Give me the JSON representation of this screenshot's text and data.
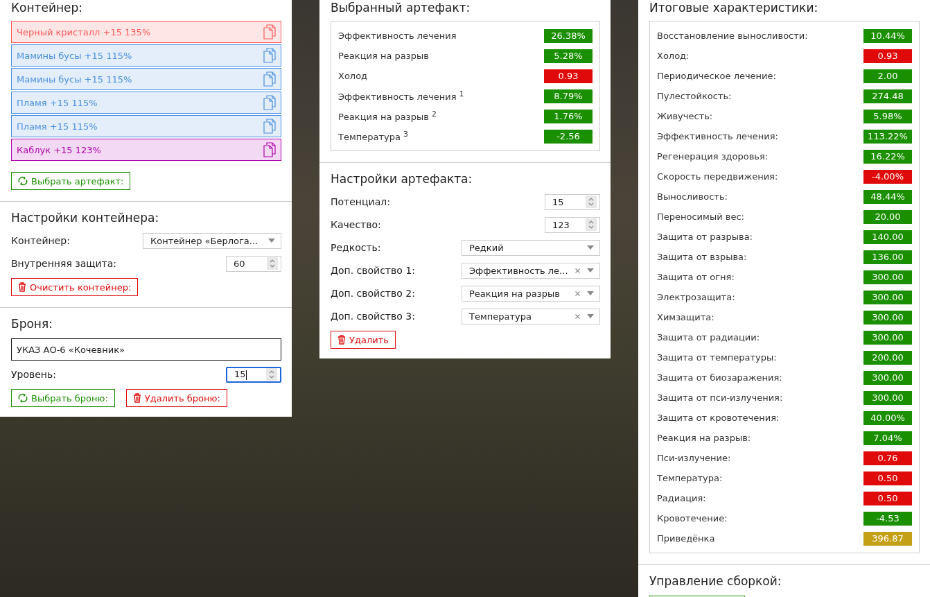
{
  "container": {
    "title": "Контейнер:",
    "artifacts": [
      {
        "label": "Черный кристалл +15 135%",
        "color": "#ff5a5a"
      },
      {
        "label": "Мамины бусы +15 115%",
        "color": "#4a90e2"
      },
      {
        "label": "Мамины бусы +15 115%",
        "color": "#4a90e2"
      },
      {
        "label": "Пламя +15 115%",
        "color": "#4a90e2"
      },
      {
        "label": "Пламя +15 115%",
        "color": "#4a90e2"
      },
      {
        "label": "Каблук +15 123%",
        "color": "#b000b0"
      }
    ],
    "pick_button": "Выбрать артефакт:"
  },
  "container_settings": {
    "title": "Настройки контейнера:",
    "fields": [
      {
        "kind": "select",
        "label": "Контейнер:",
        "value": "Контейнер «Берлога..."
      },
      {
        "kind": "number",
        "label": "Внутренняя защита:",
        "value": "60",
        "focused": false
      }
    ],
    "clear_button": "Очистить контейнер:"
  },
  "armor": {
    "title": "Броня:",
    "name": "УКАЗ АО-6 «Кочевник»",
    "fields": [
      {
        "kind": "number",
        "label": "Уровень:",
        "value": "15",
        "focused": true
      }
    ],
    "pick_button": "Выбрать броню:",
    "delete_button": "Удалить броню:"
  },
  "selected_artifact": {
    "title": "Выбранный артефакт:",
    "stats": [
      {
        "label": "Эффективность лечения",
        "value": "26.38%",
        "color": "#1a9000"
      },
      {
        "label": "Реакция на разрыв",
        "value": "5.28%",
        "color": "#1a9000"
      },
      {
        "label": "Холод",
        "value": "0.93",
        "color": "#e00a0a"
      },
      {
        "label": "Эффективность лечения $^{1}$",
        "value": "8.79%",
        "color": "#1a9000"
      },
      {
        "label": "Реакция на разрыв $^{2}$",
        "value": "1.76%",
        "color": "#1a9000"
      },
      {
        "label": "Температура $^{3}$",
        "value": "-2.56",
        "color": "#1a9000"
      }
    ]
  },
  "artifact_settings": {
    "title": "Настройки артефакта:",
    "fields": [
      {
        "kind": "number",
        "label": "Потенциал:",
        "value": "15",
        "focused": false
      },
      {
        "kind": "number",
        "label": "Качество:",
        "value": "123",
        "focused": false
      },
      {
        "kind": "select",
        "label": "Редкость:",
        "value": "Редкий"
      },
      {
        "kind": "select",
        "label": "Доп. свойство 1:",
        "value": "Эффективность ле...",
        "clearable": true
      },
      {
        "kind": "select",
        "label": "Доп. свойство 2:",
        "value": "Реакция на разрыв",
        "clearable": true
      },
      {
        "kind": "select",
        "label": "Доп. свойство 3:",
        "value": "Температура",
        "clearable": true
      }
    ],
    "delete_button": "Удалить"
  },
  "totals": {
    "title": "Итоговые характеристики:",
    "stats": [
      {
        "label": "Восстановление выносливости:",
        "value": "10.44%",
        "color": "#1a9000"
      },
      {
        "label": "Холод:",
        "value": "0.93",
        "color": "#e00a0a"
      },
      {
        "label": "Периодическое лечение:",
        "value": "2.00",
        "color": "#1a9000"
      },
      {
        "label": "Пулестойкость:",
        "value": "274.48",
        "color": "#1a9000"
      },
      {
        "label": "Живучесть:",
        "value": "5.98%",
        "color": "#1a9000"
      },
      {
        "label": "Эффективность лечения:",
        "value": "113.22%",
        "color": "#1a9000"
      },
      {
        "label": "Регенерация здоровья:",
        "value": "16.22%",
        "color": "#1a9000"
      },
      {
        "label": "Скорость передвижения:",
        "value": "-4.00%",
        "color": "#e00a0a"
      },
      {
        "label": "Выносливость:",
        "value": "48.44%",
        "color": "#1a9000"
      },
      {
        "label": "Переносимый вес:",
        "value": "20.00",
        "color": "#1a9000"
      },
      {
        "label": "Защита от разрыва:",
        "value": "140.00",
        "color": "#1a9000"
      },
      {
        "label": "Защита от взрыва:",
        "value": "136.00",
        "color": "#1a9000"
      },
      {
        "label": "Защита от огня:",
        "value": "300.00",
        "color": "#1a9000"
      },
      {
        "label": "Электрозащита:",
        "value": "300.00",
        "color": "#1a9000"
      },
      {
        "label": "Химзащита:",
        "value": "300.00",
        "color": "#1a9000"
      },
      {
        "label": "Защита от радиации:",
        "value": "300.00",
        "color": "#1a9000"
      },
      {
        "label": "Защита от температуры:",
        "value": "200.00",
        "color": "#1a9000"
      },
      {
        "label": "Защита от биозаражения:",
        "value": "300.00",
        "color": "#1a9000"
      },
      {
        "label": "Защита от пси-излучения:",
        "value": "300.00",
        "color": "#1a9000"
      },
      {
        "label": "Защита от кровотечения:",
        "value": "40.00%",
        "color": "#1a9000"
      },
      {
        "label": "Реакция на разрыв:",
        "value": "7.04%",
        "color": "#1a9000"
      },
      {
        "label": "Пси-излучение:",
        "value": "0.76",
        "color": "#e00a0a"
      },
      {
        "label": "Температура:",
        "value": "0.50",
        "color": "#e00a0a"
      },
      {
        "label": "Радиация:",
        "value": "0.50",
        "color": "#e00a0a"
      },
      {
        "label": "Кровотечение:",
        "value": "-4.53",
        "color": "#1a9000"
      },
      {
        "label": "Приведёнка",
        "value": "396.87",
        "color": "#c4a016"
      }
    ]
  },
  "build": {
    "title": "Управление сборкой:"
  }
}
